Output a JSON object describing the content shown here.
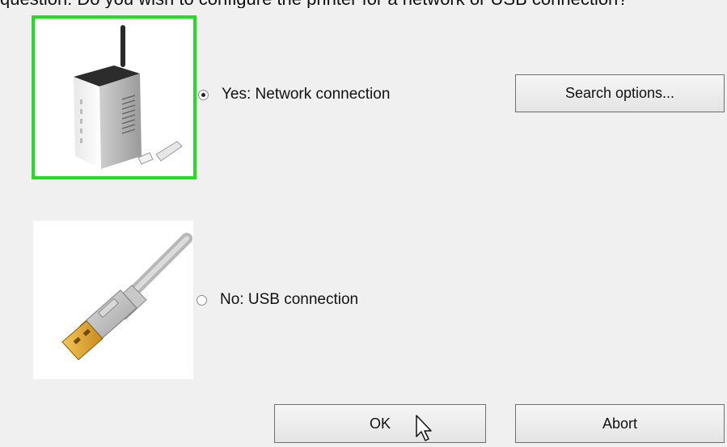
{
  "top_text": "question: Do you wish to configure the printer for a network or USB connection?",
  "options": {
    "network": {
      "label": "Yes: Network connection",
      "selected": true
    },
    "usb": {
      "label": "No: USB connection",
      "selected": false
    }
  },
  "buttons": {
    "search_options": "Search options...",
    "ok": "OK",
    "abort": "Abort"
  },
  "colors": {
    "selection_border": "#22dd22",
    "background": "#f0f0f0"
  }
}
